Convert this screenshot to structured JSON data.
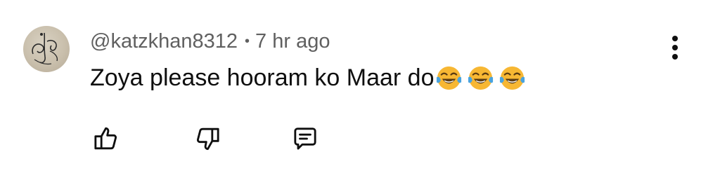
{
  "comment": {
    "username": "@katzkhan8312",
    "separator": "•",
    "time": "7 hr ago",
    "text": "Zoya please hooram ko Maar do",
    "emojis": [
      "face-with-tears-of-joy",
      "face-with-tears-of-joy",
      "face-with-tears-of-joy"
    ]
  },
  "icons": {
    "more": "vertical-ellipsis-icon",
    "like": "thumbs-up-icon",
    "dislike": "thumbs-down-icon",
    "reply": "reply-comment-icon"
  },
  "colors": {
    "text_primary": "#0f0f0f",
    "text_secondary": "#606060",
    "emoji_face": "#f7b733",
    "emoji_tears": "#4aa3df"
  }
}
